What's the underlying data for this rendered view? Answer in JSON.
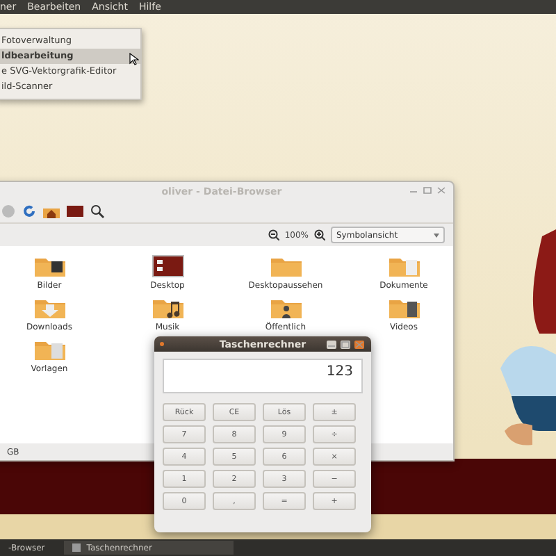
{
  "top_panel": {
    "menu": [
      "ner",
      "Bearbeiten",
      "Ansicht",
      "Hilfe"
    ]
  },
  "app_menu": {
    "items": [
      {
        "label": "Fotoverwaltung",
        "selected": false
      },
      {
        "label": "ldbearbeitung",
        "selected": true
      },
      {
        "label": "e SVG-Vektorgrafik-Editor",
        "selected": false
      },
      {
        "label": "ild-Scanner",
        "selected": false
      }
    ]
  },
  "file_browser": {
    "title": "oliver - Datei-Browser",
    "zoom": "100%",
    "view_mode": "Symbolansicht",
    "items": [
      {
        "label": "Bilder",
        "kind": "pictures"
      },
      {
        "label": "Desktop",
        "kind": "desktop"
      },
      {
        "label": "Desktopaussehen",
        "kind": "folder"
      },
      {
        "label": "Dokumente",
        "kind": "documents"
      },
      {
        "label": "Downloads",
        "kind": "downloads"
      },
      {
        "label": "Musik",
        "kind": "music"
      },
      {
        "label": "Öffentlich",
        "kind": "public"
      },
      {
        "label": "Videos",
        "kind": "videos"
      },
      {
        "label": "Vorlagen",
        "kind": "templates"
      }
    ],
    "status": "GB"
  },
  "calculator": {
    "title": "Taschenrechner",
    "display": "123",
    "buttons": [
      "Rück",
      "CE",
      "Lös",
      "±",
      "7",
      "8",
      "9",
      "÷",
      "4",
      "5",
      "6",
      "×",
      "1",
      "2",
      "3",
      "−",
      "0",
      ",",
      "=",
      "+"
    ]
  },
  "taskbar": [
    {
      "label": "-Browser",
      "selected": false
    },
    {
      "label": "Taschenrechner",
      "selected": true
    }
  ]
}
